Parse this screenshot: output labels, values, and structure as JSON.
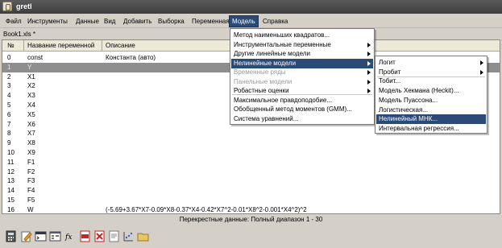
{
  "window": {
    "title": "gretl"
  },
  "menubar": [
    "Файл",
    "Инструменты",
    "Данные",
    "Вид",
    "Добавить",
    "Выборка",
    "Переменная",
    "Модель",
    "Справка"
  ],
  "filename": "Book1.xls *",
  "table": {
    "headers": {
      "num": "№",
      "name": "Название переменной",
      "desc": "Описание"
    },
    "rows": [
      {
        "num": "0",
        "name": "const",
        "desc": "Константа (авто)"
      },
      {
        "num": "1",
        "name": "Y",
        "desc": ""
      },
      {
        "num": "2",
        "name": "X1",
        "desc": ""
      },
      {
        "num": "3",
        "name": "X2",
        "desc": ""
      },
      {
        "num": "4",
        "name": "X3",
        "desc": ""
      },
      {
        "num": "5",
        "name": "X4",
        "desc": ""
      },
      {
        "num": "6",
        "name": "X5",
        "desc": ""
      },
      {
        "num": "7",
        "name": "X6",
        "desc": ""
      },
      {
        "num": "8",
        "name": "X7",
        "desc": ""
      },
      {
        "num": "9",
        "name": "X8",
        "desc": ""
      },
      {
        "num": "10",
        "name": "X9",
        "desc": ""
      },
      {
        "num": "11",
        "name": "F1",
        "desc": ""
      },
      {
        "num": "12",
        "name": "F2",
        "desc": ""
      },
      {
        "num": "13",
        "name": "F3",
        "desc": ""
      },
      {
        "num": "14",
        "name": "F4",
        "desc": ""
      },
      {
        "num": "15",
        "name": "F5",
        "desc": ""
      },
      {
        "num": "16",
        "name": "W",
        "desc": "(-5.69+3.67*X7-0.09*X8-0.37*X4-0.42*X7^2-0.01*X8^2-0.001*X4^2)^2"
      }
    ]
  },
  "status": "Перекрестные данные: Полный диапазон 1 - 30",
  "model_menu": [
    {
      "label": "Метод наименьших квадратов...",
      "submenu": false,
      "disabled": false
    },
    {
      "label": "Инструментальные переменные",
      "submenu": true,
      "disabled": false
    },
    {
      "label": "Другие линейные модели",
      "submenu": true,
      "disabled": false
    },
    {
      "label": "Нелинейные модели",
      "submenu": true,
      "disabled": false,
      "highlight": true
    },
    {
      "label": "Временные ряды",
      "submenu": true,
      "disabled": true
    },
    {
      "label": "Панельные модели",
      "submenu": true,
      "disabled": true
    },
    {
      "label": "Робастные оценки",
      "submenu": true,
      "disabled": false
    },
    {
      "label": "Максимальное правдоподобие...",
      "submenu": false,
      "disabled": false
    },
    {
      "label": "Обобщенный метод моментов (GMM)...",
      "submenu": false,
      "disabled": false
    },
    {
      "label": "Система уравнений...",
      "submenu": false,
      "disabled": false
    }
  ],
  "nonlinear_menu": [
    {
      "label": "Логит",
      "submenu": true
    },
    {
      "label": "Пробит",
      "submenu": true
    },
    {
      "label": "Тобит...",
      "submenu": false
    },
    {
      "label": "Модель Хекмана (Heckit)...",
      "submenu": false
    },
    {
      "label": "Модель Пуассона...",
      "submenu": false
    },
    {
      "label": "Логистическая...",
      "submenu": false
    },
    {
      "label": "Нелинейный МНК...",
      "submenu": false,
      "highlight": true
    },
    {
      "label": "Интервальная регрессия...",
      "submenu": false
    }
  ],
  "toolbar": [
    "calculator-icon",
    "edit-icon",
    "terminal-icon",
    "session-icon",
    "function-icon",
    "pdf-icon",
    "pdf-icon",
    "help-icon",
    "chart-icon",
    "folder-icon"
  ]
}
